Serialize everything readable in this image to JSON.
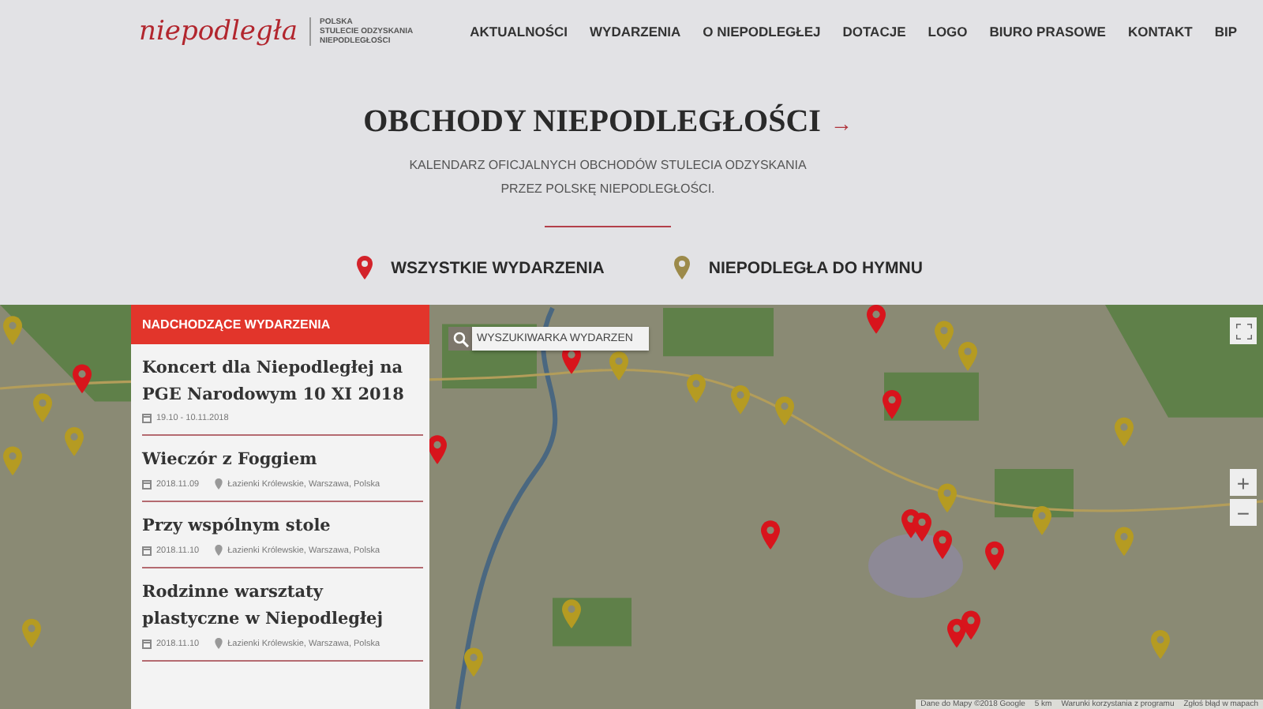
{
  "logo": {
    "script": "niepodległa",
    "tagline": [
      "POLSKA",
      "STULECIE ODZYSKANIA",
      "NIEPODLEGŁOŚCI"
    ]
  },
  "nav": [
    {
      "label": "AKTUALNOŚCI"
    },
    {
      "label": "WYDARZENIA"
    },
    {
      "label": "O NIEPODLEGŁEJ"
    },
    {
      "label": "DOTACJE"
    },
    {
      "label": "LOGO"
    },
    {
      "label": "BIURO PRASOWE"
    },
    {
      "label": "KONTAKT"
    },
    {
      "label": "BIP"
    }
  ],
  "hero": {
    "title": "OBCHODY NIEPODLEGŁOŚCI",
    "arrow": "→",
    "subtitle": [
      "KALENDARZ OFICJALNYCH OBCHODÓW STULECIA ODZYSKANIA",
      "PRZEZ POLSKĘ NIEPODLEGŁOŚCI."
    ]
  },
  "legend": [
    {
      "label": "WSZYSTKIE WYDARZENIA",
      "color": "#d3222a"
    },
    {
      "label": "NIEPODLEGŁA DO HYMNU",
      "color": "#9c8a4a"
    }
  ],
  "events_panel": {
    "title": "NADCHODZĄCE WYDARZENIA",
    "events": [
      {
        "title": "Koncert dla Niepodległej na PGE Narodowym 10 XI 2018",
        "date": "19.10 - 10.11.2018"
      },
      {
        "title": "Wieczór z Foggiem",
        "date": "2018.11.09",
        "place": "Łazienki Królewskie, Warszawa, Polska"
      },
      {
        "title": "Przy wspólnym stole",
        "date": "2018.11.10",
        "place": "Łazienki Królewskie, Warszawa, Polska"
      },
      {
        "title": "Rodzinne warsztaty plastyczne w Niepodległej",
        "date": "2018.11.10",
        "place": "Łazienki Królewskie, Warszawa, Polska"
      }
    ]
  },
  "map": {
    "search": {
      "placeholder": "WYSZUKIWARKA WYDARZEN"
    },
    "zoom_in": "+",
    "zoom_out": "−",
    "attribution": [
      "Dane do Mapy ©2018 Google",
      "5 km",
      "Warunki korzystania z programu",
      "Zgłoś błąd w mapach"
    ]
  }
}
